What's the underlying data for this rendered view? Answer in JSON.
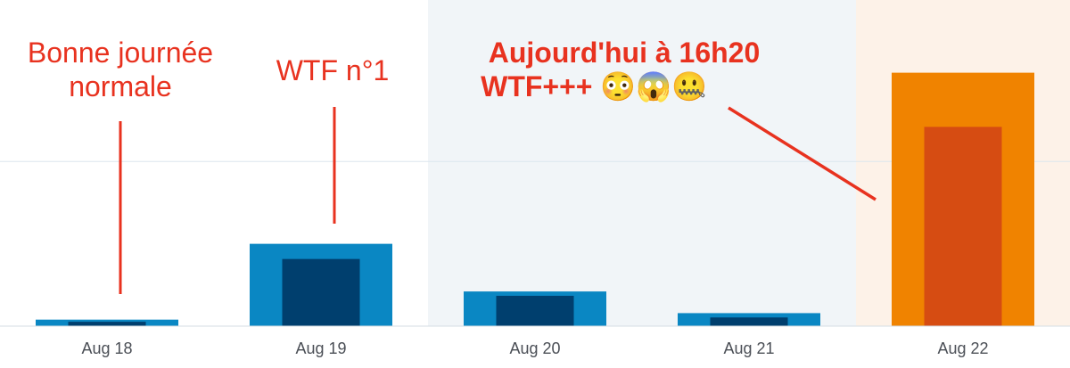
{
  "colors": {
    "views": "#0a87c3",
    "visitors": "#003f6e",
    "highlight_views": "#f08300",
    "highlight_visitors": "#d64c12",
    "weekend_band": "#f1f5f8",
    "today_band": "#fdf2e8",
    "annotation": "#e8321f",
    "gridline": "#dbe6ee"
  },
  "annotations": {
    "normal_day": {
      "line1": "Bonne journée",
      "line2": "normale"
    },
    "wtf_one": {
      "text": "WTF n°1"
    },
    "today": {
      "line1": "Aujourd'hui à 16h20",
      "line2": "WTF+++ 😳😱🤐"
    }
  },
  "chart_data": {
    "type": "bar",
    "categories": [
      "Aug 18",
      "Aug 19",
      "Aug 20",
      "Aug 21",
      "Aug 22"
    ],
    "series": [
      {
        "values": [
          3,
          38,
          16,
          6,
          117
        ]
      },
      {
        "values": [
          2,
          31,
          14,
          4,
          92
        ]
      }
    ],
    "ylim": [
      0,
      130
    ],
    "gridline_values": [
      76
    ],
    "weekend_categories": [
      "Aug 20",
      "Aug 21"
    ],
    "highlight_category": "Aug 22",
    "grid": true,
    "legend": "none"
  }
}
